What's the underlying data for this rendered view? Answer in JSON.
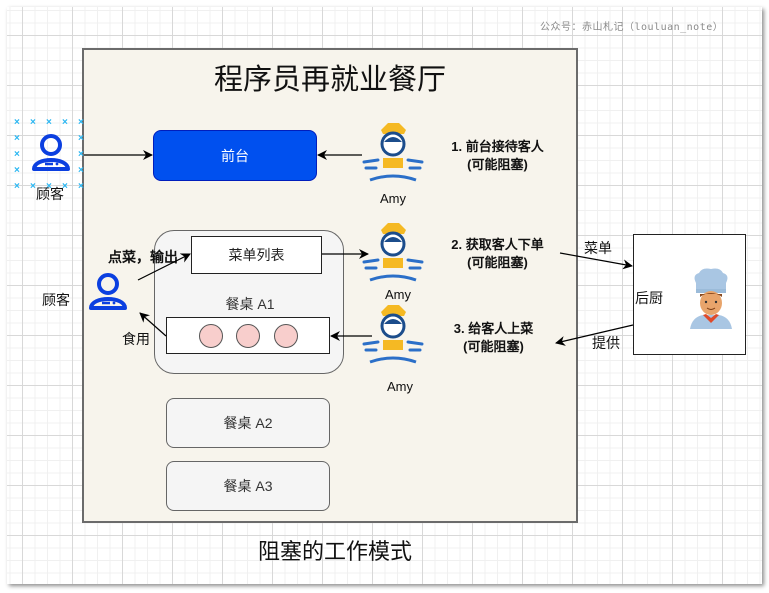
{
  "watermark": "公众号：赤山札记（louluan_note）",
  "title": "程序员再就业餐厅",
  "subtitle": "阻塞的工作模式",
  "front_desk": {
    "label": "前台"
  },
  "customers": [
    {
      "label": "顾客",
      "icon": "user-icon",
      "selected": true
    },
    {
      "label": "顾客",
      "icon": "user-icon",
      "selected": false
    }
  ],
  "waiters": [
    {
      "name": "Amy",
      "icon": "waitress-icon"
    },
    {
      "name": "Amy",
      "icon": "waitress-icon"
    },
    {
      "name": "Amy",
      "icon": "waitress-icon"
    }
  ],
  "steps": [
    {
      "line1": "1. 前台接待客人",
      "line2": "(可能阻塞)"
    },
    {
      "line1": "2.  获取客人下单",
      "line2": "(可能阻塞)"
    },
    {
      "line1": "3.  给客人上菜",
      "line2": "(可能阻塞)"
    }
  ],
  "table_a1": {
    "label": "餐桌 A1",
    "menu_label": "菜单列表",
    "dishes": 3
  },
  "tables": [
    {
      "label": "餐桌 A2"
    },
    {
      "label": "餐桌 A3"
    }
  ],
  "edge_labels": {
    "order_output": "点菜，输出",
    "eat": "食用",
    "menu": "菜单",
    "provide": "提供"
  },
  "kitchen": {
    "label": "后厨",
    "icon": "chef-icon"
  },
  "colors": {
    "front_desk": "#0050ef",
    "user_icon": "#0b3fe0",
    "dish": "#f8cecc",
    "restaurant_bg": "#f7f4ec"
  }
}
